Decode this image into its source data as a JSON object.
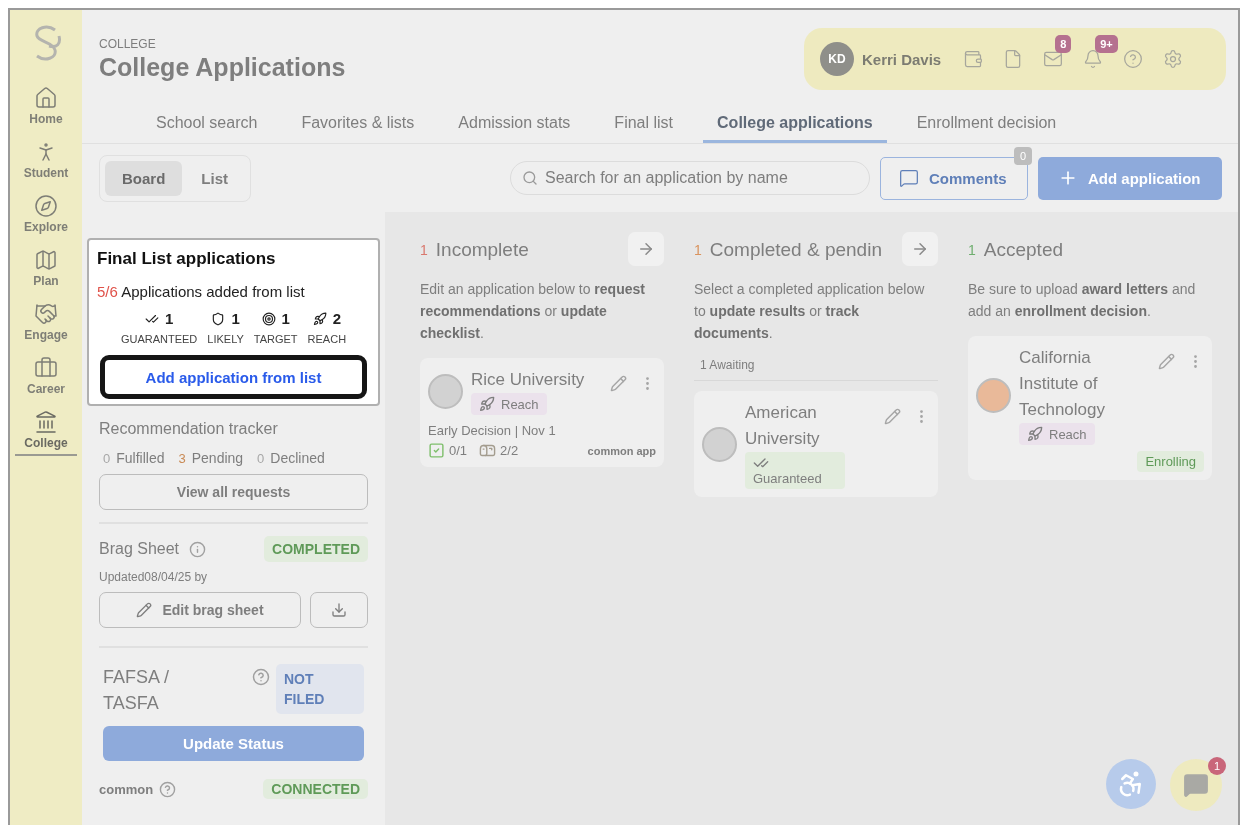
{
  "sidebar": {
    "items": [
      {
        "label": "Home",
        "selected": false
      },
      {
        "label": "Student",
        "selected": false
      },
      {
        "label": "Explore",
        "selected": false
      },
      {
        "label": "Plan",
        "selected": false
      },
      {
        "label": "Engage",
        "selected": false
      },
      {
        "label": "Career",
        "selected": false
      },
      {
        "label": "College",
        "selected": true
      }
    ]
  },
  "header": {
    "section": "COLLEGE",
    "title": "College Applications"
  },
  "user": {
    "initials": "KD",
    "name": "Kerri Davis",
    "mail_badge": "8",
    "bell_badge": "9+"
  },
  "tabs": [
    {
      "label": "School search",
      "selected": false
    },
    {
      "label": "Favorites & lists",
      "selected": false
    },
    {
      "label": "Admission stats",
      "selected": false
    },
    {
      "label": "Final list",
      "selected": false
    },
    {
      "label": "College applications",
      "selected": true
    },
    {
      "label": "Enrollment decision",
      "selected": false
    }
  ],
  "view_toggle": [
    {
      "label": "Board",
      "selected": true
    },
    {
      "label": "List",
      "selected": false
    }
  ],
  "search": {
    "placeholder": "Search for an application by name"
  },
  "comments": {
    "label": "Comments",
    "count": "0"
  },
  "add_button": "Add application",
  "popup": {
    "title": "Final List applications",
    "count": "5/6",
    "text": "Applications added from list",
    "stats": [
      {
        "kind": "guaranteed",
        "count": "1",
        "label": "GUARANTEED"
      },
      {
        "kind": "likely",
        "count": "1",
        "label": "LIKELY"
      },
      {
        "kind": "target",
        "count": "1",
        "label": "TARGET"
      },
      {
        "kind": "reach",
        "count": "2",
        "label": "REACH"
      }
    ],
    "button": "Add application from list"
  },
  "recommendations": {
    "title": "Recommendation tracker",
    "stats": [
      {
        "count": "0",
        "label": "Fulfilled",
        "color": "#a8a8a8"
      },
      {
        "count": "3",
        "label": "Pending",
        "color": "#c98a55"
      },
      {
        "count": "0",
        "label": "Declined",
        "color": "#a8a8a8"
      }
    ],
    "button": "View all requests"
  },
  "brag_sheet": {
    "title": "Brag Sheet",
    "status": "COMPLETED",
    "updated": "Updated08/04/25 by",
    "edit_button": "Edit brag sheet"
  },
  "fafsa": {
    "title": "FAFSA / TASFA",
    "status": "NOT FILED",
    "button": "Update Status"
  },
  "common_app": {
    "logo": "common",
    "status": "CONNECTED"
  },
  "columns": [
    {
      "count": "1",
      "color": "#d9786e",
      "title": "Incomplete",
      "arrow": true,
      "description": "Edit an application below to **request recommendations** or **update checklist**.",
      "cards": [
        {
          "name": "Rice University",
          "color": "#d2d2d2",
          "tag": {
            "kind": "reach",
            "label": "Reach"
          },
          "decision": "Early Decision | Nov 1",
          "checklist": "0/1",
          "documents": "2/2",
          "logo": "common app"
        }
      ]
    },
    {
      "count": "1",
      "color": "#d9935e",
      "title": "Completed & pendin",
      "arrow": true,
      "description": "Select a completed application below to **update results** or **track documents**.",
      "awaiting": "1 Awaiting",
      "cards": [
        {
          "name": "American University",
          "color": "#d2d2d2",
          "tag": {
            "kind": "guaranteed",
            "label": "Guaranteed"
          }
        }
      ]
    },
    {
      "count": "1",
      "color": "#6fae6f",
      "title": "Accepted",
      "arrow": false,
      "description": "Be sure to upload **award letters** and add an **enrollment decision**.",
      "cards": [
        {
          "name": "California Institute of Technology",
          "color": "#e9b999",
          "tag": {
            "kind": "reach",
            "label": "Reach"
          },
          "enrolling": "Enrolling"
        }
      ]
    }
  ],
  "chat_badge": "1"
}
